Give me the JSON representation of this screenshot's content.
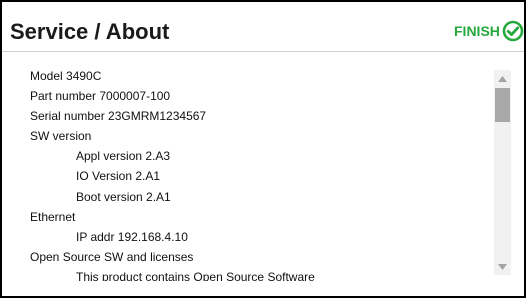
{
  "header": {
    "title": "Service / About",
    "finish_label": "FINISH",
    "finish_icon": "check-circle-icon",
    "accent_color": "#27a83d"
  },
  "info": {
    "model": "Model 3490C",
    "part_number": "Part number 7000007-100",
    "serial_number": "Serial number 23GMRM1234567",
    "sw_version_heading": "SW version",
    "appl_version": "Appl version 2.A3",
    "io_version": "IO Version 2.A1",
    "boot_version": "Boot version 2.A1",
    "ethernet_heading": "Ethernet",
    "ip_addr": "IP addr 192.168.4.10",
    "open_source_heading": "Open Source SW and licenses",
    "open_source_text": "This product contains Open Source Software"
  },
  "scrollbar": {
    "up_icon": "triangle-up-icon",
    "down_icon": "triangle-down-icon"
  }
}
